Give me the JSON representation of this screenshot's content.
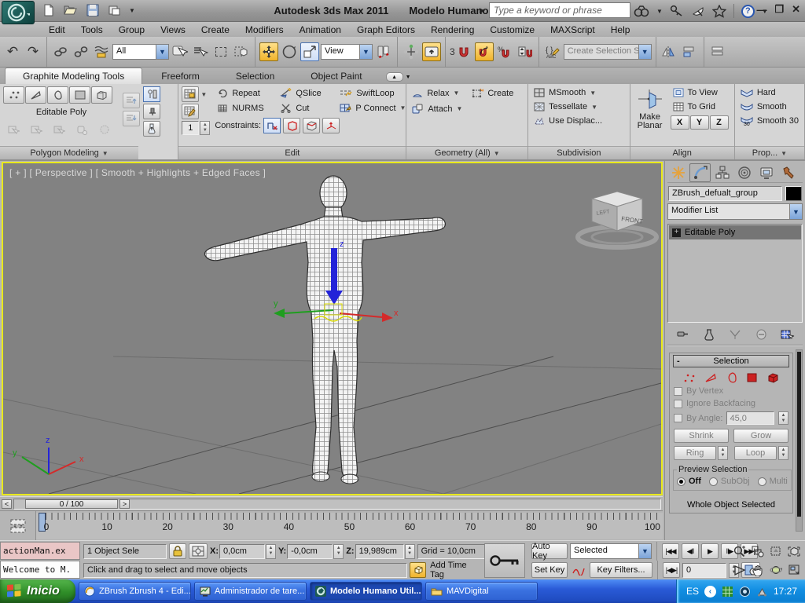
{
  "titlebar": {
    "app_title": "Autodesk 3ds Max  2011",
    "doc_title": "Modelo Humano Util.max",
    "search_placeholder": "Type a keyword or phrase",
    "minimize": "—",
    "restore": "❐",
    "close": "✕"
  },
  "menu": {
    "items": [
      "Edit",
      "Tools",
      "Group",
      "Views",
      "Create",
      "Modifiers",
      "Animation",
      "Graph Editors",
      "Rendering",
      "Customize",
      "MAXScript",
      "Help"
    ]
  },
  "toolbar": {
    "filter_value": "All",
    "view_value": "View",
    "snaps_label": "3",
    "selection_set_placeholder": "Create Selection Se"
  },
  "ribbon": {
    "tabs": [
      "Graphite Modeling Tools",
      "Freeform",
      "Selection",
      "Object Paint"
    ],
    "polygon_modeling": {
      "object_label": "Editable Poly",
      "footer": "Polygon Modeling"
    },
    "edit": {
      "repeat": "Repeat",
      "qslice": "QSlice",
      "swiftloop": "SwiftLoop",
      "nurms": "NURMS",
      "cut": "Cut",
      "pconnect": "P Connect",
      "constraints_label": "Constraints:",
      "iterations": "1",
      "footer": "Edit"
    },
    "geometry": {
      "relax": "Relax",
      "create": "Create",
      "attach": "Attach",
      "footer": "Geometry (All)"
    },
    "subdivision": {
      "msmooth": "MSmooth",
      "tessellate": "Tessellate",
      "use_displacement": "Use Displac...",
      "footer": "Subdivision"
    },
    "align": {
      "make_planar_1": "Make",
      "make_planar_2": "Planar",
      "to_view": "To View",
      "to_grid": "To Grid",
      "x": "X",
      "y": "Y",
      "z": "Z",
      "footer": "Align"
    },
    "properties": {
      "hard": "Hard",
      "smooth": "Smooth",
      "smooth30": "Smooth 30",
      "footer": "Prop..."
    }
  },
  "viewport": {
    "label": "[ + ] [ Perspective ] [ Smooth + Highlights + Edged Faces ]",
    "viewcube_face": "FRONT",
    "gizmo": {
      "x": "x",
      "y": "y",
      "z": "z"
    },
    "world_axis": {
      "x": "x",
      "y": "y",
      "z": "z"
    }
  },
  "command_panel": {
    "object_name": "ZBrush_defualt_group",
    "modifier_list_label": "Modifier List",
    "stack_item": "Editable Poly",
    "selection": {
      "collapse": "-",
      "title": "Selection",
      "by_vertex": "By Vertex",
      "ignore_backfacing": "Ignore Backfacing",
      "by_angle_label": "By Angle:",
      "by_angle_value": "45,0",
      "shrink": "Shrink",
      "grow": "Grow",
      "ring": "Ring",
      "loop": "Loop",
      "preview_title": "Preview Selection",
      "off": "Off",
      "subobj": "SubObj",
      "multi": "Multi",
      "status": "Whole Object Selected"
    }
  },
  "timeline": {
    "prev": "<",
    "next": ">",
    "slider_value": "0 / 100",
    "ticks": [
      "0",
      "10",
      "20",
      "30",
      "40",
      "50",
      "60",
      "70",
      "80",
      "90",
      "100"
    ]
  },
  "status": {
    "listener_line1": "actionMan.ex",
    "listener_line2": "Welcome to M.",
    "selection_count": "1 Object Sele",
    "x_label": "X:",
    "x_value": "0,0cm",
    "y_label": "Y:",
    "y_value": "-0,0cm",
    "z_label": "Z:",
    "z_value": "19,989cm",
    "grid_value": "Grid = 10,0cm",
    "prompt": "Click and drag to select and move objects",
    "add_time_tag": "Add Time Tag",
    "auto_key": "Auto Key",
    "set_key": "Set Key",
    "key_mode_value": "Selected",
    "key_filters": "Key Filters...",
    "frame_value": "0"
  },
  "taskbar": {
    "start": "Inicio",
    "tasks": [
      "ZBrush Zbrush 4 - Edi...",
      "Administrador de tare...",
      "Modelo Humano Util....",
      "MAVDigital"
    ],
    "lang": "ES",
    "time": "17:27"
  },
  "colors": {
    "accent_yellow": "#F2B32C",
    "viewport_border": "#E9E91C",
    "taskbar_blue": "#2A5BD7",
    "start_green": "#2F8D28",
    "subobject_red": "#CC2222",
    "gizmo_x_red": "#D42A2A",
    "gizmo_y_green": "#1F9E1F",
    "gizmo_z_blue": "#2323D8"
  }
}
